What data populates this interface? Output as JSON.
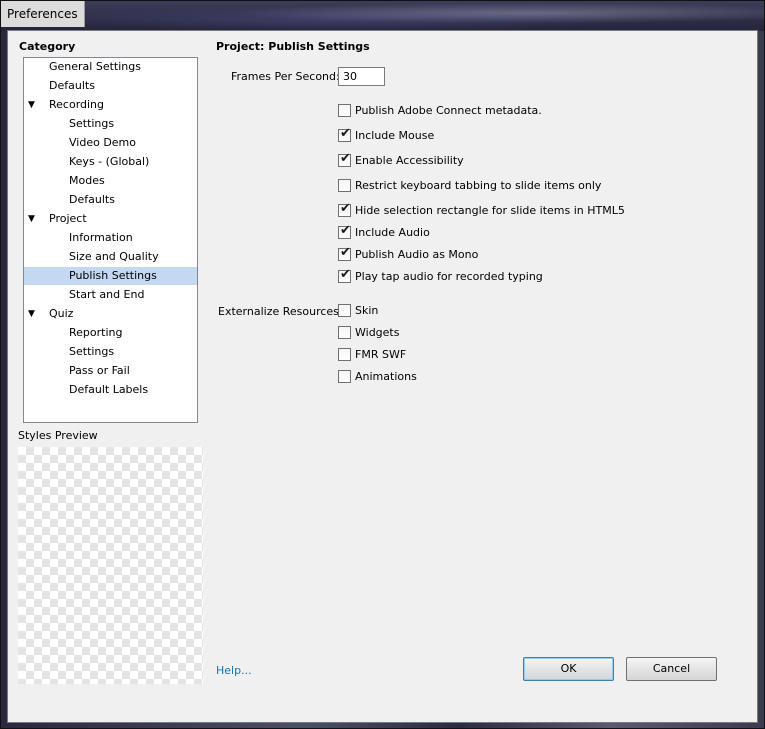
{
  "window": {
    "title": "Preferences"
  },
  "category": {
    "heading": "Category",
    "items": [
      {
        "label": "General Settings",
        "level": 0,
        "expanded": false,
        "selected": false
      },
      {
        "label": "Defaults",
        "level": 0,
        "expanded": false,
        "selected": false
      },
      {
        "label": "Recording",
        "level": 0,
        "expanded": true,
        "selected": false
      },
      {
        "label": "Settings",
        "level": 1,
        "selected": false
      },
      {
        "label": "Video Demo",
        "level": 1,
        "selected": false
      },
      {
        "label": "Keys - (Global)",
        "level": 1,
        "selected": false
      },
      {
        "label": "Modes",
        "level": 1,
        "selected": false
      },
      {
        "label": "Defaults",
        "level": 1,
        "selected": false
      },
      {
        "label": "Project",
        "level": 0,
        "expanded": true,
        "selected": false
      },
      {
        "label": "Information",
        "level": 1,
        "selected": false
      },
      {
        "label": "Size and Quality",
        "level": 1,
        "selected": false
      },
      {
        "label": "Publish Settings",
        "level": 1,
        "selected": true
      },
      {
        "label": "Start and End",
        "level": 1,
        "selected": false
      },
      {
        "label": "Quiz",
        "level": 0,
        "expanded": true,
        "selected": false
      },
      {
        "label": "Reporting",
        "level": 1,
        "selected": false
      },
      {
        "label": "Settings",
        "level": 1,
        "selected": false
      },
      {
        "label": "Pass or Fail",
        "level": 1,
        "selected": false
      },
      {
        "label": "Default Labels",
        "level": 1,
        "selected": false
      }
    ]
  },
  "styles_preview": {
    "label": "Styles Preview"
  },
  "panel": {
    "heading": "Project: Publish Settings",
    "fps": {
      "label": "Frames Per Second:",
      "value": "30"
    },
    "options": [
      {
        "label": "Publish Adobe Connect metadata.",
        "checked": false
      },
      {
        "label": "Include Mouse",
        "checked": true
      },
      {
        "label": "Enable Accessibility",
        "checked": true
      },
      {
        "label": "Restrict keyboard tabbing to slide items only",
        "checked": false
      },
      {
        "label": "Hide selection rectangle for slide items in HTML5",
        "checked": true
      },
      {
        "label": "Include Audio",
        "checked": true
      },
      {
        "label": "Publish Audio as Mono",
        "checked": true
      },
      {
        "label": "Play tap audio for recorded typing",
        "checked": true
      }
    ],
    "externalize": {
      "label": "Externalize Resources:",
      "options": [
        {
          "label": "Skin",
          "checked": false
        },
        {
          "label": "Widgets",
          "checked": false
        },
        {
          "label": "FMR SWF",
          "checked": false
        },
        {
          "label": "Animations",
          "checked": false
        }
      ]
    }
  },
  "footer": {
    "help_label": "Help...",
    "ok_label": "OK",
    "cancel_label": "Cancel"
  },
  "colors": {
    "selection": "#c4d8f2",
    "link": "#1a6fb0"
  }
}
